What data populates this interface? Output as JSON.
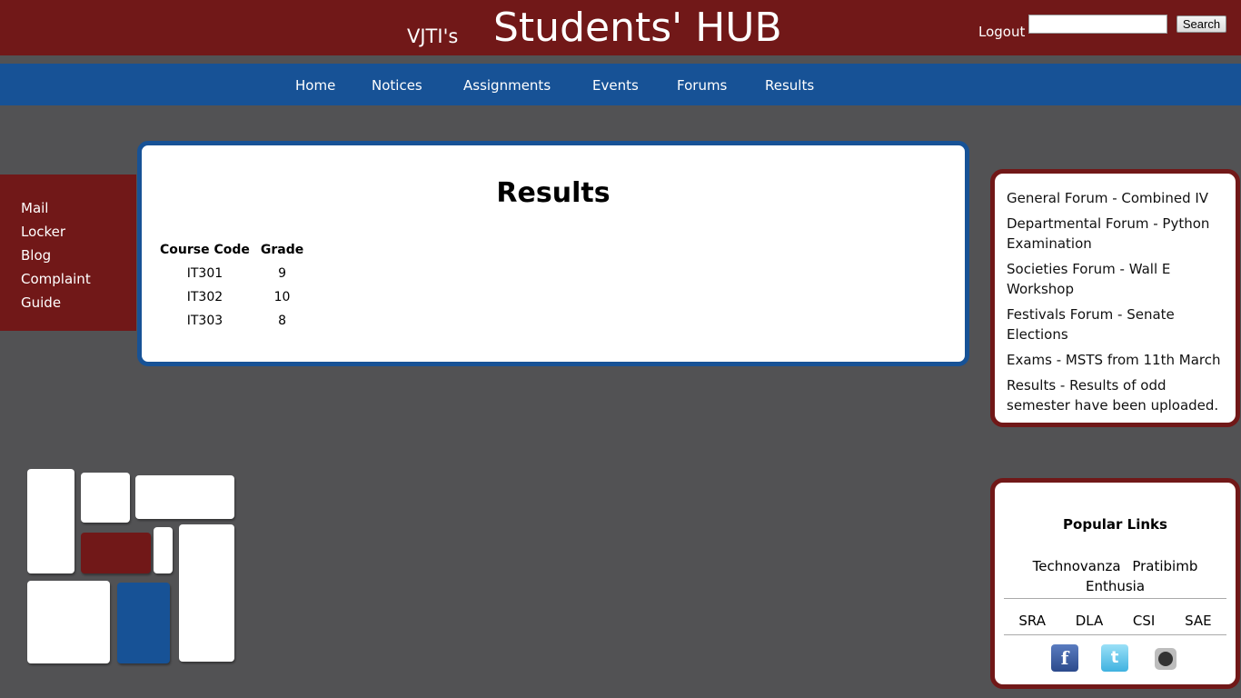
{
  "header": {
    "brand_small": "VJTI's",
    "brand_big": "Students' HUB",
    "logout": "Logout",
    "search_value": "",
    "search_button": "Search"
  },
  "nav": {
    "items": [
      {
        "label": "Home"
      },
      {
        "label": "Notices"
      },
      {
        "label": "Assignments"
      },
      {
        "label": "Events"
      },
      {
        "label": "Forums"
      },
      {
        "label": "Results"
      }
    ]
  },
  "sidebar": {
    "items": [
      {
        "label": "Mail"
      },
      {
        "label": "Locker"
      },
      {
        "label": "Blog"
      },
      {
        "label": "Complaint"
      },
      {
        "label": "Guide"
      }
    ]
  },
  "main": {
    "title": "Results",
    "columns": [
      "Course Code",
      "Grade"
    ],
    "rows": [
      {
        "code": "IT301",
        "grade": "9"
      },
      {
        "code": "IT302",
        "grade": "10"
      },
      {
        "code": "IT303",
        "grade": "8"
      }
    ]
  },
  "notices": {
    "items": [
      {
        "text": "General Forum - Combined IV"
      },
      {
        "text": "Departmental Forum - Python Examination"
      },
      {
        "text": "Societies Forum - Wall E Workshop"
      },
      {
        "text": "Festivals Forum - Senate Elections"
      },
      {
        "text": "Exams - MSTS from 11th March"
      },
      {
        "text": "Results - Results of odd semester have been uploaded."
      }
    ]
  },
  "popular": {
    "title": "Popular Links",
    "row1": [
      "Technovanza",
      "Pratibimb",
      "Enthusia"
    ],
    "row2": [
      "SRA",
      "DLA",
      "CSI",
      "SAE"
    ],
    "social": {
      "facebook_icon": "facebook-icon",
      "twitter_icon": "twitter-icon",
      "github_icon": "github-icon"
    }
  },
  "colors": {
    "maroon": "#711818",
    "blue": "#175296",
    "background": "#525254"
  }
}
